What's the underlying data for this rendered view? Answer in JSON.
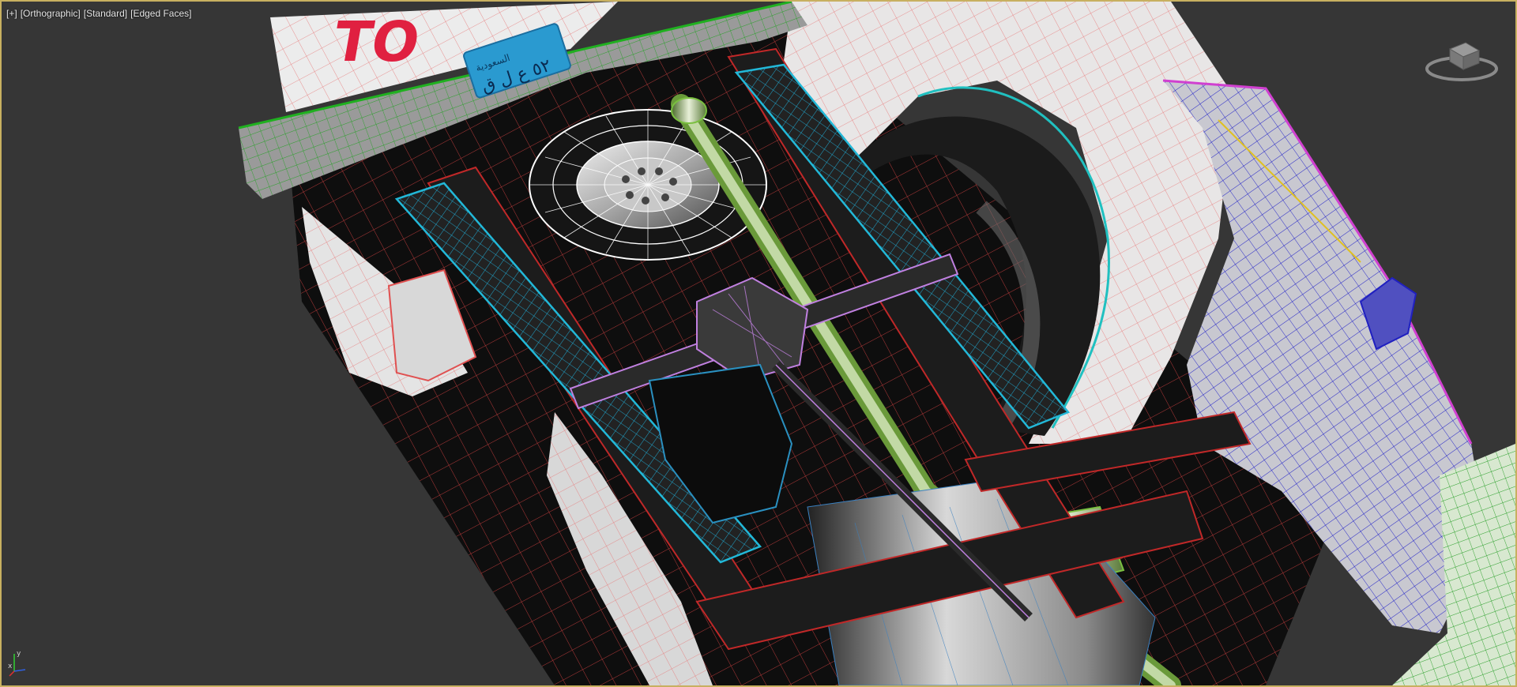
{
  "viewport": {
    "menu_label": "[+]",
    "view_label": "[Orthographic]",
    "shading_label": "[Standard]",
    "edged_label": "[Edged Faces]"
  },
  "license_plate": {
    "text": "٥٢ ع ل ق",
    "header": "السعودية"
  },
  "tailgate_text": "TO",
  "viewcube": {
    "icon": "viewcube-icon"
  },
  "axis_tripod": {
    "x_label": "x",
    "y_label": "y",
    "icon": "axis-tripod-icon"
  },
  "colors": {
    "background": "#363636",
    "frame_border": "#c8b060",
    "body_wire": "#e05a5a",
    "bumper_wire": "#30b030",
    "leaf_spring_wire": "#22b8d8",
    "axle_wire": "#c080e0",
    "door_wire": "#2a2ad0",
    "exhaust_wire": "#8ad060",
    "spare_wheel_wire": "#ffffff",
    "chassis_fill": "#1a1a1a"
  }
}
